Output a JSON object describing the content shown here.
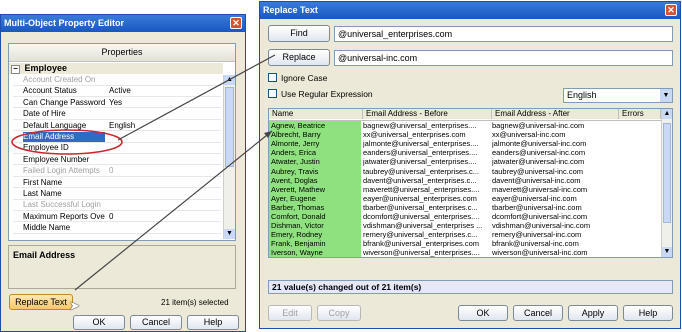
{
  "left_window": {
    "title": "Multi-Object Property Editor",
    "header": "Properties",
    "category": "Employee",
    "properties": [
      {
        "name": "Account Created On",
        "value": "",
        "dim": true
      },
      {
        "name": "Account Status",
        "value": "Active",
        "dim": false
      },
      {
        "name": "Can Change Password",
        "value": "Yes",
        "dim": false
      },
      {
        "name": "Date of Hire",
        "value": "",
        "dim": false
      },
      {
        "name": "Default Language",
        "value": "English",
        "dim": false
      },
      {
        "name": "Email Address",
        "value": "",
        "dim": false,
        "selected": true
      },
      {
        "name": "Employee ID",
        "value": "",
        "dim": false
      },
      {
        "name": "Employee Number",
        "value": "",
        "dim": false
      },
      {
        "name": "Failed Login Attempts",
        "value": "0",
        "dim": true
      },
      {
        "name": "First Name",
        "value": "",
        "dim": false
      },
      {
        "name": "Last Name",
        "value": "",
        "dim": false
      },
      {
        "name": "Last Successful Login",
        "value": "",
        "dim": true
      },
      {
        "name": "Maximum Reports Overrid",
        "value": "0",
        "dim": false
      },
      {
        "name": "Middle Name",
        "value": "",
        "dim": false
      }
    ],
    "description_title": "Email Address",
    "replace_text_button": "Replace Text",
    "selection_status": "21 item(s) selected",
    "ok": "OK",
    "cancel": "Cancel",
    "help": "Help"
  },
  "right_window": {
    "title": "Replace Text",
    "find_button": "Find",
    "find_value": "@universal_enterprises.com",
    "replace_button": "Replace",
    "replace_value": "@universal-inc.com",
    "ignore_case_label": "Ignore Case",
    "regex_label": "Use Regular Expression",
    "language_select": "English",
    "columns": [
      "Name",
      "Email Address - Before",
      "Email Address - After",
      "Errors"
    ],
    "rows": [
      {
        "name": "Agnew, Beatrice",
        "before": "bagnew@universal_enterprises....",
        "after": "bagnew@universal-inc.com"
      },
      {
        "name": "Albrecht, Barry",
        "before": "xx@universal_enterprises.com",
        "after": "xx@universal-inc.com"
      },
      {
        "name": "Almonte, Jerry",
        "before": "jalmonte@universal_enterprises....",
        "after": "jalmonte@universal-inc.com"
      },
      {
        "name": "Anders, Erica",
        "before": "eanders@universal_enterprises....",
        "after": "eanders@universal-inc.com"
      },
      {
        "name": "Atwater, Justin",
        "before": "jatwater@universal_enterprises....",
        "after": "jatwater@universal-inc.com"
      },
      {
        "name": "Aubrey, Travis",
        "before": "taubrey@universal_enterprises.c...",
        "after": "taubrey@universal-inc.com"
      },
      {
        "name": "Avent, Doglas",
        "before": "davent@universal_enterprises.c...",
        "after": "davent@universal-inc.com"
      },
      {
        "name": "Averett, Mathew",
        "before": "maverett@universal_enterprises....",
        "after": "maverett@universal-inc.com"
      },
      {
        "name": "Ayer, Eugene",
        "before": "eayer@universal_enterprises.com",
        "after": "eayer@universal-inc.com"
      },
      {
        "name": "Barber, Thomas",
        "before": "tbarber@universal_enterprises.c...",
        "after": "tbarber@universal-inc.com"
      },
      {
        "name": "Comfort, Donald",
        "before": "dcomfort@universal_enterprises....",
        "after": "dcomfort@universal-inc.com"
      },
      {
        "name": "Dishman, Victor",
        "before": "vdishman@universal_enterprises ...",
        "after": "vdishman@universal-inc.com"
      },
      {
        "name": "Emery, Rodney",
        "before": "remery@universal_enterprises.c...",
        "after": "remery@universal-inc.com"
      },
      {
        "name": "Frank, Benjamin",
        "before": "bfrank@universal_enterprises.com",
        "after": "bfrank@universal-inc.com"
      },
      {
        "name": "Iverson, Wayne",
        "before": "wiverson@universal_enterprises....",
        "after": "wiverson@universal-inc.com"
      }
    ],
    "status_text": "21 value(s) changed out of 21 item(s)",
    "edit": "Edit",
    "copy": "Copy",
    "ok": "OK",
    "cancel": "Cancel",
    "apply": "Apply",
    "help": "Help"
  },
  "colors": {
    "titlebar": "#2a66c9",
    "name_cell": "#8fe07f",
    "selection": "#316ac5",
    "annotation": "#c8282f"
  }
}
